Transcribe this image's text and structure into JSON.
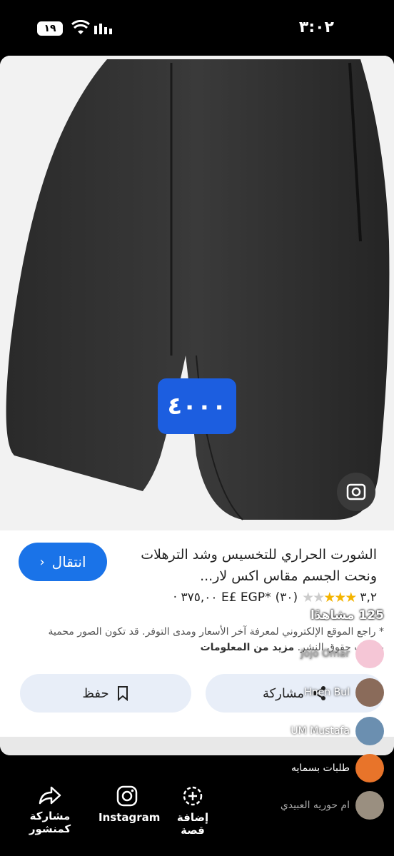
{
  "status": {
    "time": "٣:٠٢",
    "battery": "١٩"
  },
  "product": {
    "price_badge": "٤٠٠٠",
    "go_label": "انتقال",
    "title": "الشورت الحراري للتخسيس وشد الترهلات ونحت الجسم مقاس اكس لار...",
    "rating": "٣,٢",
    "reviews": "(٣٠)",
    "price": "*E£ EGP ٣٧٥,٠٠ ·",
    "note_text": "* راجع الموقع الإلكتروني لمعرفة آخر الأسعار ومدى التوفر. قد تكون الصور محمية بموجب حقوق النشر.",
    "more_info": "مزيد من المعلومات",
    "save_label": "حفظ",
    "share_label": "مشاركة"
  },
  "live": {
    "views": "125 مشاهدًا",
    "comments": [
      {
        "name": "Jojo Omar",
        "color": "#f5c6d6"
      },
      {
        "name": "Hnen Bul",
        "color": "#8a6b5a"
      },
      {
        "name": "UM Mustafa",
        "color": "#6b8fb0"
      },
      {
        "name": "طلبات بسمايه",
        "color": "#e8742a"
      },
      {
        "name": "ام حوريه العبيدي",
        "color": "#9a8f80"
      }
    ]
  },
  "bottom_bar": {
    "story_label": "إضافة قصة",
    "instagram_label": "Instagram",
    "share_post_label": "مشاركة كمنشور"
  }
}
